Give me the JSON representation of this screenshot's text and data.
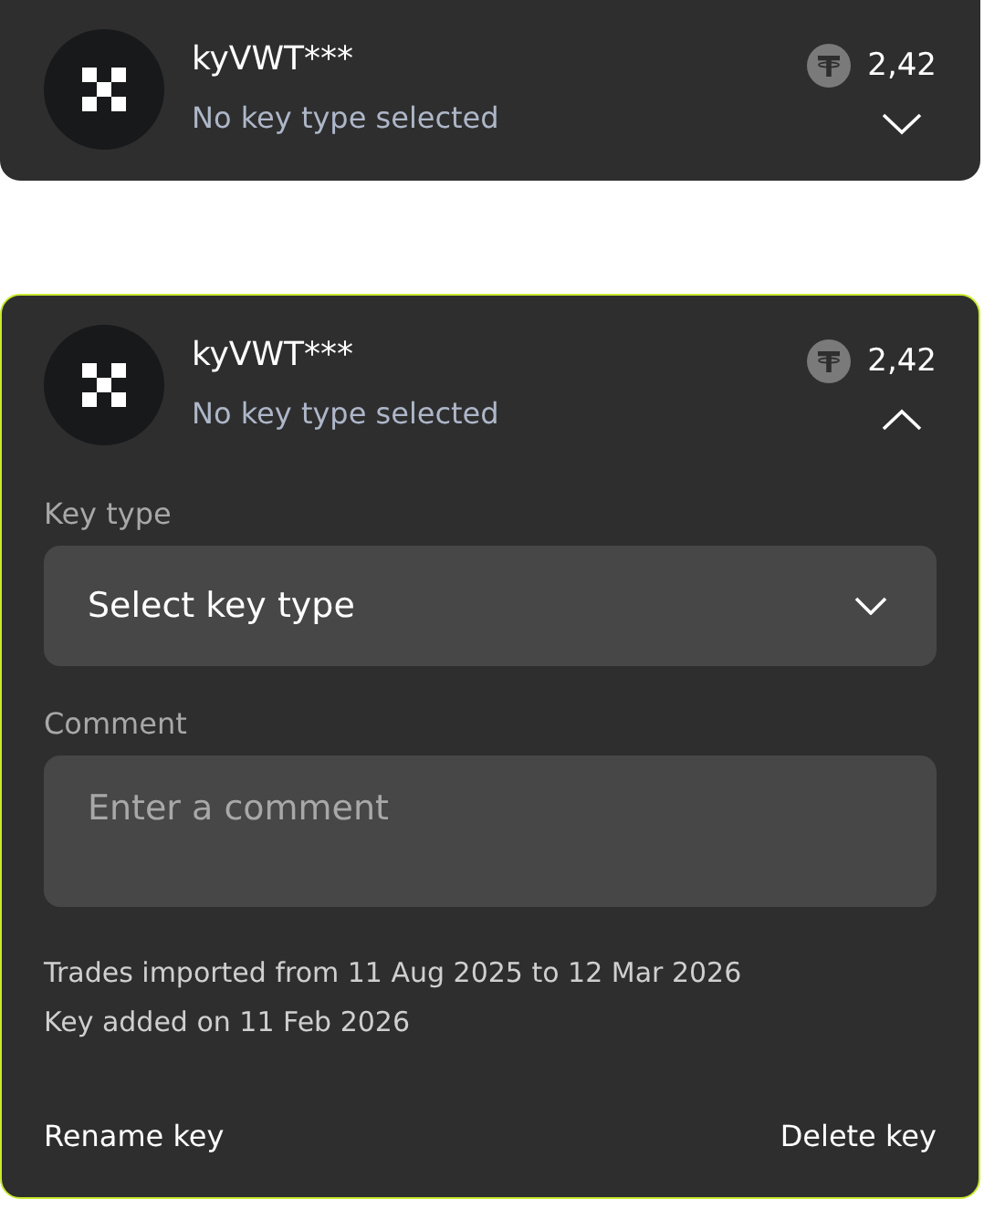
{
  "keys": [
    {
      "name": "kyVWT***",
      "subtitle": "No key type selected",
      "balance": "2,42",
      "expanded": false
    },
    {
      "name": "kyVWT***",
      "subtitle": "No key type selected",
      "balance": "2,42",
      "expanded": true,
      "key_type": {
        "label": "Key type",
        "value": "Select key type"
      },
      "comment": {
        "label": "Comment",
        "placeholder": "Enter a comment"
      },
      "info": [
        "Trades imported from 11 Aug 2025 to 12 Mar 2026",
        "Key added on 11 Feb 2026"
      ],
      "actions": [
        "Rename key",
        "Delete key"
      ]
    }
  ]
}
